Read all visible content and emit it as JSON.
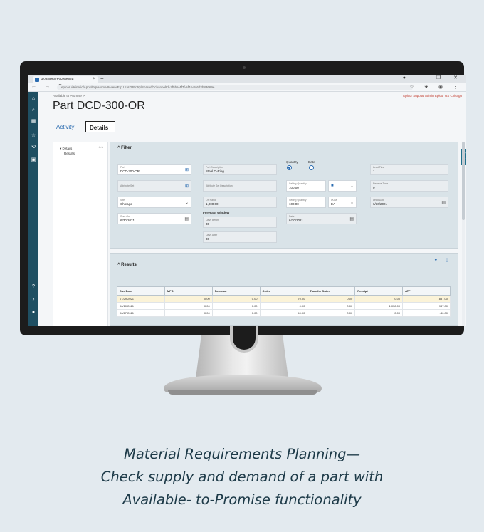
{
  "browser": {
    "tab_title": "Available to Promise",
    "tab_close": "×",
    "new_tab": "+",
    "window_buttons": "● — ❐ ✕",
    "nav_buttons": "← → C",
    "url": "epicorui/Kinetic/Apps/Erp/Home/#/view/Erp.UI.ATPEntry/Shared/?channelId=7f5ba-4f7f-af74-8a6d2b83669e",
    "addr_icons": "☆ ★ ◉ ⋮"
  },
  "app": {
    "breadcrumb": "Available to Promise >",
    "user_menu": "Epicor Support Admin  Epicor US  Chicago",
    "page_title": "Part DCD-300-OR",
    "page_menu": "···",
    "tabs": {
      "activity": "Activity",
      "details": "Details"
    },
    "nav_icons": {
      "home": "⌂",
      "search": "⌕",
      "grid": "▦",
      "star": "☆",
      "history": "⟲",
      "apps": "▣",
      "help": "?",
      "bell": "♪",
      "user": "●"
    }
  },
  "tree": {
    "count": "4.1",
    "root": "▾ Details",
    "child": "Results"
  },
  "filter": {
    "header": "^   Filter",
    "part": {
      "label": "Part",
      "value": "DCD-300-OR"
    },
    "attribute_set": {
      "label": "Attribute Set"
    },
    "site": {
      "label": "Site",
      "value": "Chicago"
    },
    "start_on": {
      "label": "Start On",
      "value": "6/30/2021"
    },
    "part_description": {
      "label": "Part Description",
      "value": "Steel O-Ring"
    },
    "attribute_set_description": {
      "label": "Attribute Set Description"
    },
    "on_hand": {
      "label": "On Hand",
      "value": "1,000.00"
    },
    "forecast_window": "Forecast Window",
    "days_before": {
      "label": "Days Before",
      "value": "30"
    },
    "days_after": {
      "label": "Days After",
      "value": "30"
    },
    "quantity_radio": "Quantity",
    "date_radio": "Date",
    "selling_quantity": {
      "label": "Selling Quantity",
      "value": "100.00"
    },
    "uom": {
      "label": "UOM",
      "value": "EA"
    },
    "date": {
      "label": "Date",
      "value": "6/30/2021"
    },
    "lead_time": {
      "label": "Lead Time",
      "value": "1"
    },
    "receive_time": {
      "label": "Receive Time",
      "value": "0"
    },
    "lead_date": {
      "label": "Lead Date",
      "value": "6/30/2021"
    },
    "side_tab": "Overview"
  },
  "results": {
    "header": "^   Results",
    "icons": "▼ ⋮",
    "columns": [
      "Due Date",
      "MPS",
      "Forecast",
      "Order",
      "Transfer Order",
      "Receipt",
      "ATP"
    ],
    "rows": [
      [
        "07/29/2021",
        "0.00",
        "0.00",
        "70.00",
        "0.00",
        "0.00",
        "887.00"
      ],
      [
        "06/10/2021",
        "0.00",
        "0.00",
        "0.00",
        "0.00",
        "1,038.00",
        "987.00"
      ],
      [
        "06/27/2021",
        "0.00",
        "0.00",
        "40.00",
        "0.00",
        "0.00",
        "-40.00"
      ]
    ]
  },
  "caption": {
    "line1": "Material Requirements Planning—",
    "line2": "Check supply and demand of a part with",
    "line3": "Available- to-Promise functionality"
  }
}
